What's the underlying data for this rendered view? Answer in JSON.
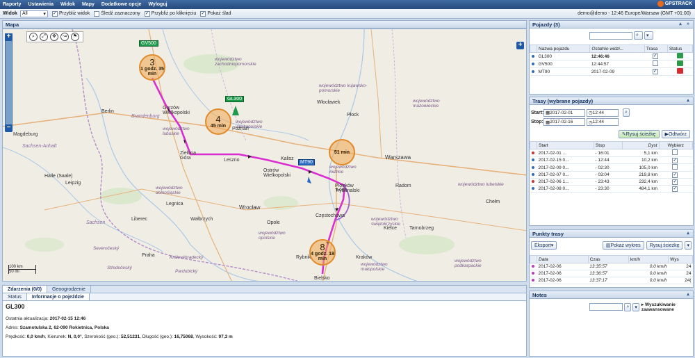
{
  "menu": [
    "Raporty",
    "Ustawienia",
    "Widok",
    "Mapy",
    "Dodatkowe opcje",
    "Wyloguj"
  ],
  "logo_text": "GPSTRACK",
  "toolbar": {
    "label": "Widok",
    "select_value": "All",
    "options": [
      "Przybliż widok",
      "Śledź zaznaczony",
      "Przybliż po kliknięciu",
      "Pokaż ślad"
    ]
  },
  "user_info": "demo@demo - 12:46 Europe/Warsaw (GMT +01:00)",
  "map": {
    "title": "Mapa",
    "scale_km": "100 km",
    "scale_mi": "50 mi",
    "cities": [
      {
        "name": "Berlin"
      },
      {
        "name": "Magdeburg"
      },
      {
        "name": "Leipzig"
      },
      {
        "name": "Halle (Saale)"
      },
      {
        "name": "Gorzów Wielkopolski"
      },
      {
        "name": "Zielona Góra"
      },
      {
        "name": "Leszno"
      },
      {
        "name": "Poznań"
      },
      {
        "name": "Kalisz"
      },
      {
        "name": "Ostrów Wielkopolski"
      },
      {
        "name": "Włocławek"
      },
      {
        "name": "Płock"
      },
      {
        "name": "Warszawa"
      },
      {
        "name": "Łódź"
      },
      {
        "name": "Piotrków Trybunalski"
      },
      {
        "name": "Radom"
      },
      {
        "name": "Częstochowa"
      },
      {
        "name": "Kielce"
      },
      {
        "name": "Wrocław"
      },
      {
        "name": "Legnica"
      },
      {
        "name": "Wałbrzych"
      },
      {
        "name": "Opole"
      },
      {
        "name": "Liberec"
      },
      {
        "name": "Praha"
      },
      {
        "name": "Rybnik"
      },
      {
        "name": "Kraków"
      },
      {
        "name": "Tarnobrzeg"
      },
      {
        "name": "Chełm"
      },
      {
        "name": "Bielsko"
      }
    ],
    "regions": [
      "województwo zachodniopomorskie",
      "województwo kujawsko-pomorskie",
      "województwo wielkopolskie",
      "województwo lubuskie",
      "województwo łódzkie",
      "województwo mazowieckie",
      "województwo dolnośląskie",
      "województwo opolskie",
      "województwo świętokrzyskie",
      "województwo małopolskie",
      "województwo podkarpackie",
      "województwo lubelskie",
      "Brandenburg",
      "Sachsen-Anhalt",
      "Sachsen",
      "Severočeský",
      "Královéhradecký",
      "Pardubický",
      "Středočeský"
    ],
    "vehicle_labels": [
      "GV500",
      "GL300",
      "MT90"
    ],
    "clusters": [
      {
        "count": "3",
        "text": "1 godz. 35 min"
      },
      {
        "count": "4",
        "text": "45 min"
      },
      {
        "count": "",
        "text": "51 min"
      },
      {
        "count": "8",
        "text": "4 godz. 18 min"
      }
    ]
  },
  "bottom": {
    "tabs": [
      "Zdarzenia (0/0)",
      "Geoogrodzenie"
    ],
    "subtabs": [
      "Status",
      "Informacje o pojeździe"
    ],
    "vehicle": "GL300",
    "last_update_label": "Ostatnia aktualizacja:",
    "last_update": "2017-02-15 12:46",
    "address_label": "Adres:",
    "address": "Szamotulska 2, 62-090 Rokietnica, Polska",
    "speed_label": "Prędkość:",
    "speed": "0,0 km/h",
    "heading_label": "Kierunek:",
    "heading": "N, 0,0°",
    "lat_label": "Szerokość (geo.):",
    "lat": "52,51231",
    "lon_label": "Długość (geo.):",
    "lon": "16,75068",
    "alt_label": "Wysokość:",
    "alt": "97,3 m"
  },
  "vehicles": {
    "title": "Pojazdy (3)",
    "columns": [
      "Nazwa pojazdu",
      "Ostatnio widzi...",
      "Trasa",
      "Status"
    ],
    "rows": [
      {
        "name": "GL300",
        "last": "12:46:46",
        "trasa": true,
        "color": "#2d9a4a"
      },
      {
        "name": "GV500",
        "last": "12:44:57",
        "trasa": false,
        "color": "#2d9a4a"
      },
      {
        "name": "MT90",
        "last": "2017-02-09",
        "trasa": true,
        "color": "#d03030"
      }
    ]
  },
  "routes": {
    "title": "Trasy (wybrane pojazdy)",
    "start_label": "Start:",
    "start_date": "2017-02-01",
    "start_time": "12:44",
    "stop_label": "Stop:",
    "stop_date": "2017-02-16",
    "stop_time": "12:44",
    "draw_btn": "Rysuj ścieżkę",
    "play_btn": "Odtwórz",
    "columns": [
      "Start",
      "Stop",
      "Dyst",
      "Wybierz"
    ],
    "rows": [
      {
        "start": "2017-02-01 ...",
        "stop": "- 16:01",
        "dist": "5,1 km",
        "sel": false,
        "color": "#d03030"
      },
      {
        "start": "2017-02-15 0...",
        "stop": "- 12:44",
        "dist": "10,2 km",
        "sel": true,
        "color": "#2a6cc5"
      },
      {
        "start": "2017-02-09 0...",
        "stop": "- 02:30",
        "dist": "105,0 km",
        "sel": false,
        "color": "#2a6cc5"
      },
      {
        "start": "2017-02-07 0...",
        "stop": "- 03:04",
        "dist": "219,8 km",
        "sel": true,
        "color": "#2a6cc5"
      },
      {
        "start": "2017-02-06 1...",
        "stop": "- 23:43",
        "dist": "232,4 km",
        "sel": true,
        "color": "#d03030"
      },
      {
        "start": "2017-02-08 0...",
        "stop": "- 23:30",
        "dist": "484,1 km",
        "sel": true,
        "color": "#2a6cc5"
      }
    ]
  },
  "points": {
    "title": "Punkty trasy",
    "export_btn": "Eksport",
    "chart_btn": "Pokaż wykres",
    "draw_btn": "Rysuj ścieżkę",
    "columns": [
      "Data",
      "Czas",
      "km/h",
      "Wys"
    ],
    "rows": [
      {
        "date": "2017-02-06",
        "time": "13:35:57",
        "speed": "0,0 km/h",
        "alt": "24"
      },
      {
        "date": "2017-02-06",
        "time": "13:36:57",
        "speed": "0,0 km/h",
        "alt": "24"
      },
      {
        "date": "2017-02-06",
        "time": "13:37:17",
        "speed": "0,0 km/h",
        "alt": "24("
      }
    ]
  },
  "notes": {
    "title": "Notes",
    "advanced": "Wyszukiwanie zaawansowane"
  }
}
